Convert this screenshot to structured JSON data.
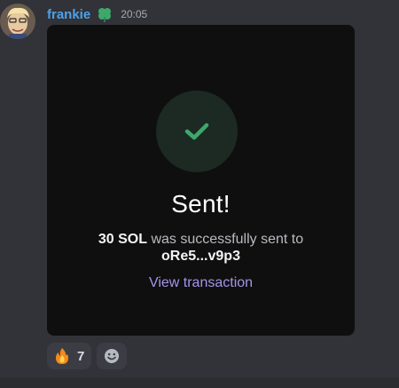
{
  "message": {
    "username": "frankie",
    "timestamp": "20:05",
    "badge_icon": "clover-icon",
    "avatar_icon": "cartoon-avatar"
  },
  "card": {
    "status_icon": "checkmark-icon",
    "title": "Sent!",
    "amount": "30 SOL",
    "body_text": " was successfully sent to ",
    "recipient": "oRe5...v9p3",
    "link_label": "View transaction"
  },
  "reactions": [
    {
      "emoji": "fire-emoji",
      "count": "7"
    }
  ],
  "add_reaction_icon": "smiley-icon",
  "colors": {
    "background": "#313338",
    "username": "#4ea1e8",
    "card_bg": "#0f0f10",
    "check_green": "#3ea86b",
    "link": "#a694e8"
  }
}
